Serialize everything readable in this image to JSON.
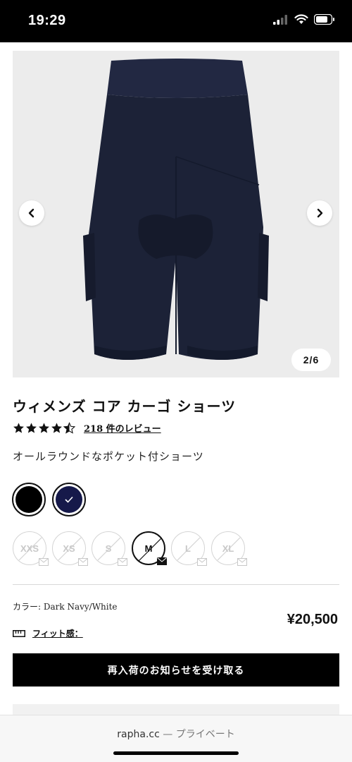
{
  "status_bar": {
    "time": "19:29"
  },
  "gallery": {
    "counter": "2/6"
  },
  "product": {
    "title": "ウィメンズ コア カーゴ ショーツ",
    "rating": 4.5,
    "review_text": "218 件のレビュー",
    "subtitle": "オールラウンドなポケット付ショーツ"
  },
  "colors": [
    {
      "name": "black",
      "hex": "#000000",
      "selected": false
    },
    {
      "name": "Dark Navy/White",
      "hex": "#16194a",
      "selected": true
    }
  ],
  "sizes": [
    {
      "label": "XXS",
      "available": false
    },
    {
      "label": "XS",
      "available": false
    },
    {
      "label": "S",
      "available": false
    },
    {
      "label": "M",
      "available": false,
      "selected": true
    },
    {
      "label": "L",
      "available": false
    },
    {
      "label": "XL",
      "available": false
    }
  ],
  "details": {
    "color_label": "カラー: Dark Navy/White",
    "price": "¥20,500",
    "fit_label": "フィット感："
  },
  "cta": {
    "label": "再入荷のお知らせを受け取る"
  },
  "browser": {
    "domain": "rapha.cc",
    "mode": "— プライベート"
  },
  "theme": {
    "navy": "#1a1f33",
    "accent": "#000000"
  }
}
